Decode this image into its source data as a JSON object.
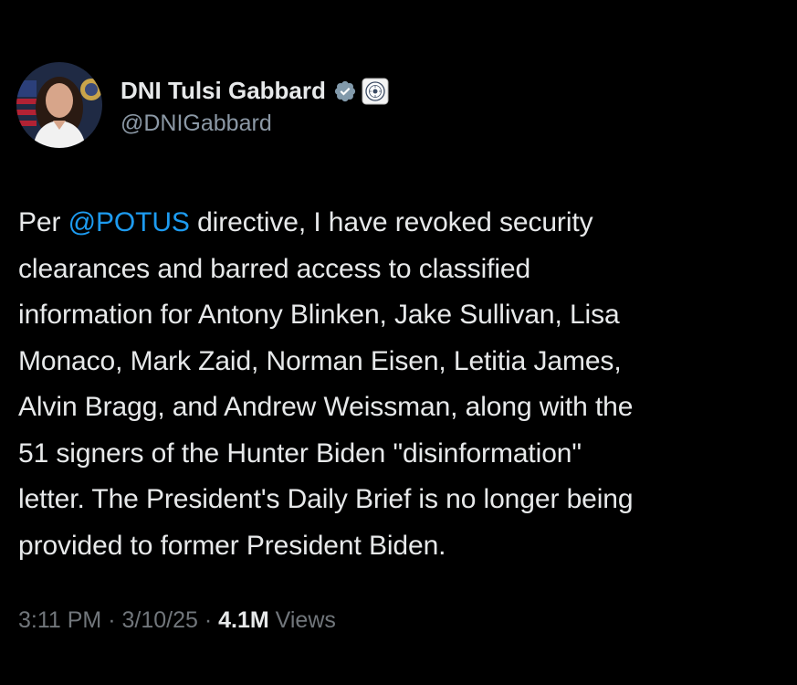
{
  "author": {
    "display_name": "DNI Tulsi Gabbard",
    "handle": "@DNIGabbard",
    "verified_icon": "verified-badge-icon",
    "affiliation_icon": "dni-seal-icon"
  },
  "tweet": {
    "lines": [
      {
        "mention": "@POTUS",
        "prefix": "Per ",
        "rest": " directive, I have revoked security"
      },
      {
        "text": "clearances and barred access to classified"
      },
      {
        "text": "information for Antony Blinken, Jake Sullivan, Lisa"
      },
      {
        "text": "Monaco, Mark Zaid, Norman Eisen, Letitia James,"
      },
      {
        "text": "Alvin Bragg, and Andrew Weissman, along with the"
      },
      {
        "text": "51 signers of the Hunter Biden \"disinformation\""
      },
      {
        "text": "letter. The President's Daily Brief is no longer being"
      },
      {
        "text": "provided to former President Biden."
      }
    ]
  },
  "meta": {
    "time": "3:11 PM",
    "separator": " · ",
    "date": "3/10/25",
    "views_count": "4.1M",
    "views_label": " Views"
  },
  "colors": {
    "background": "#000000",
    "text": "#e7e9ea",
    "secondary": "#71767b",
    "mention": "#1d9bf0",
    "verified": "#829aab"
  }
}
